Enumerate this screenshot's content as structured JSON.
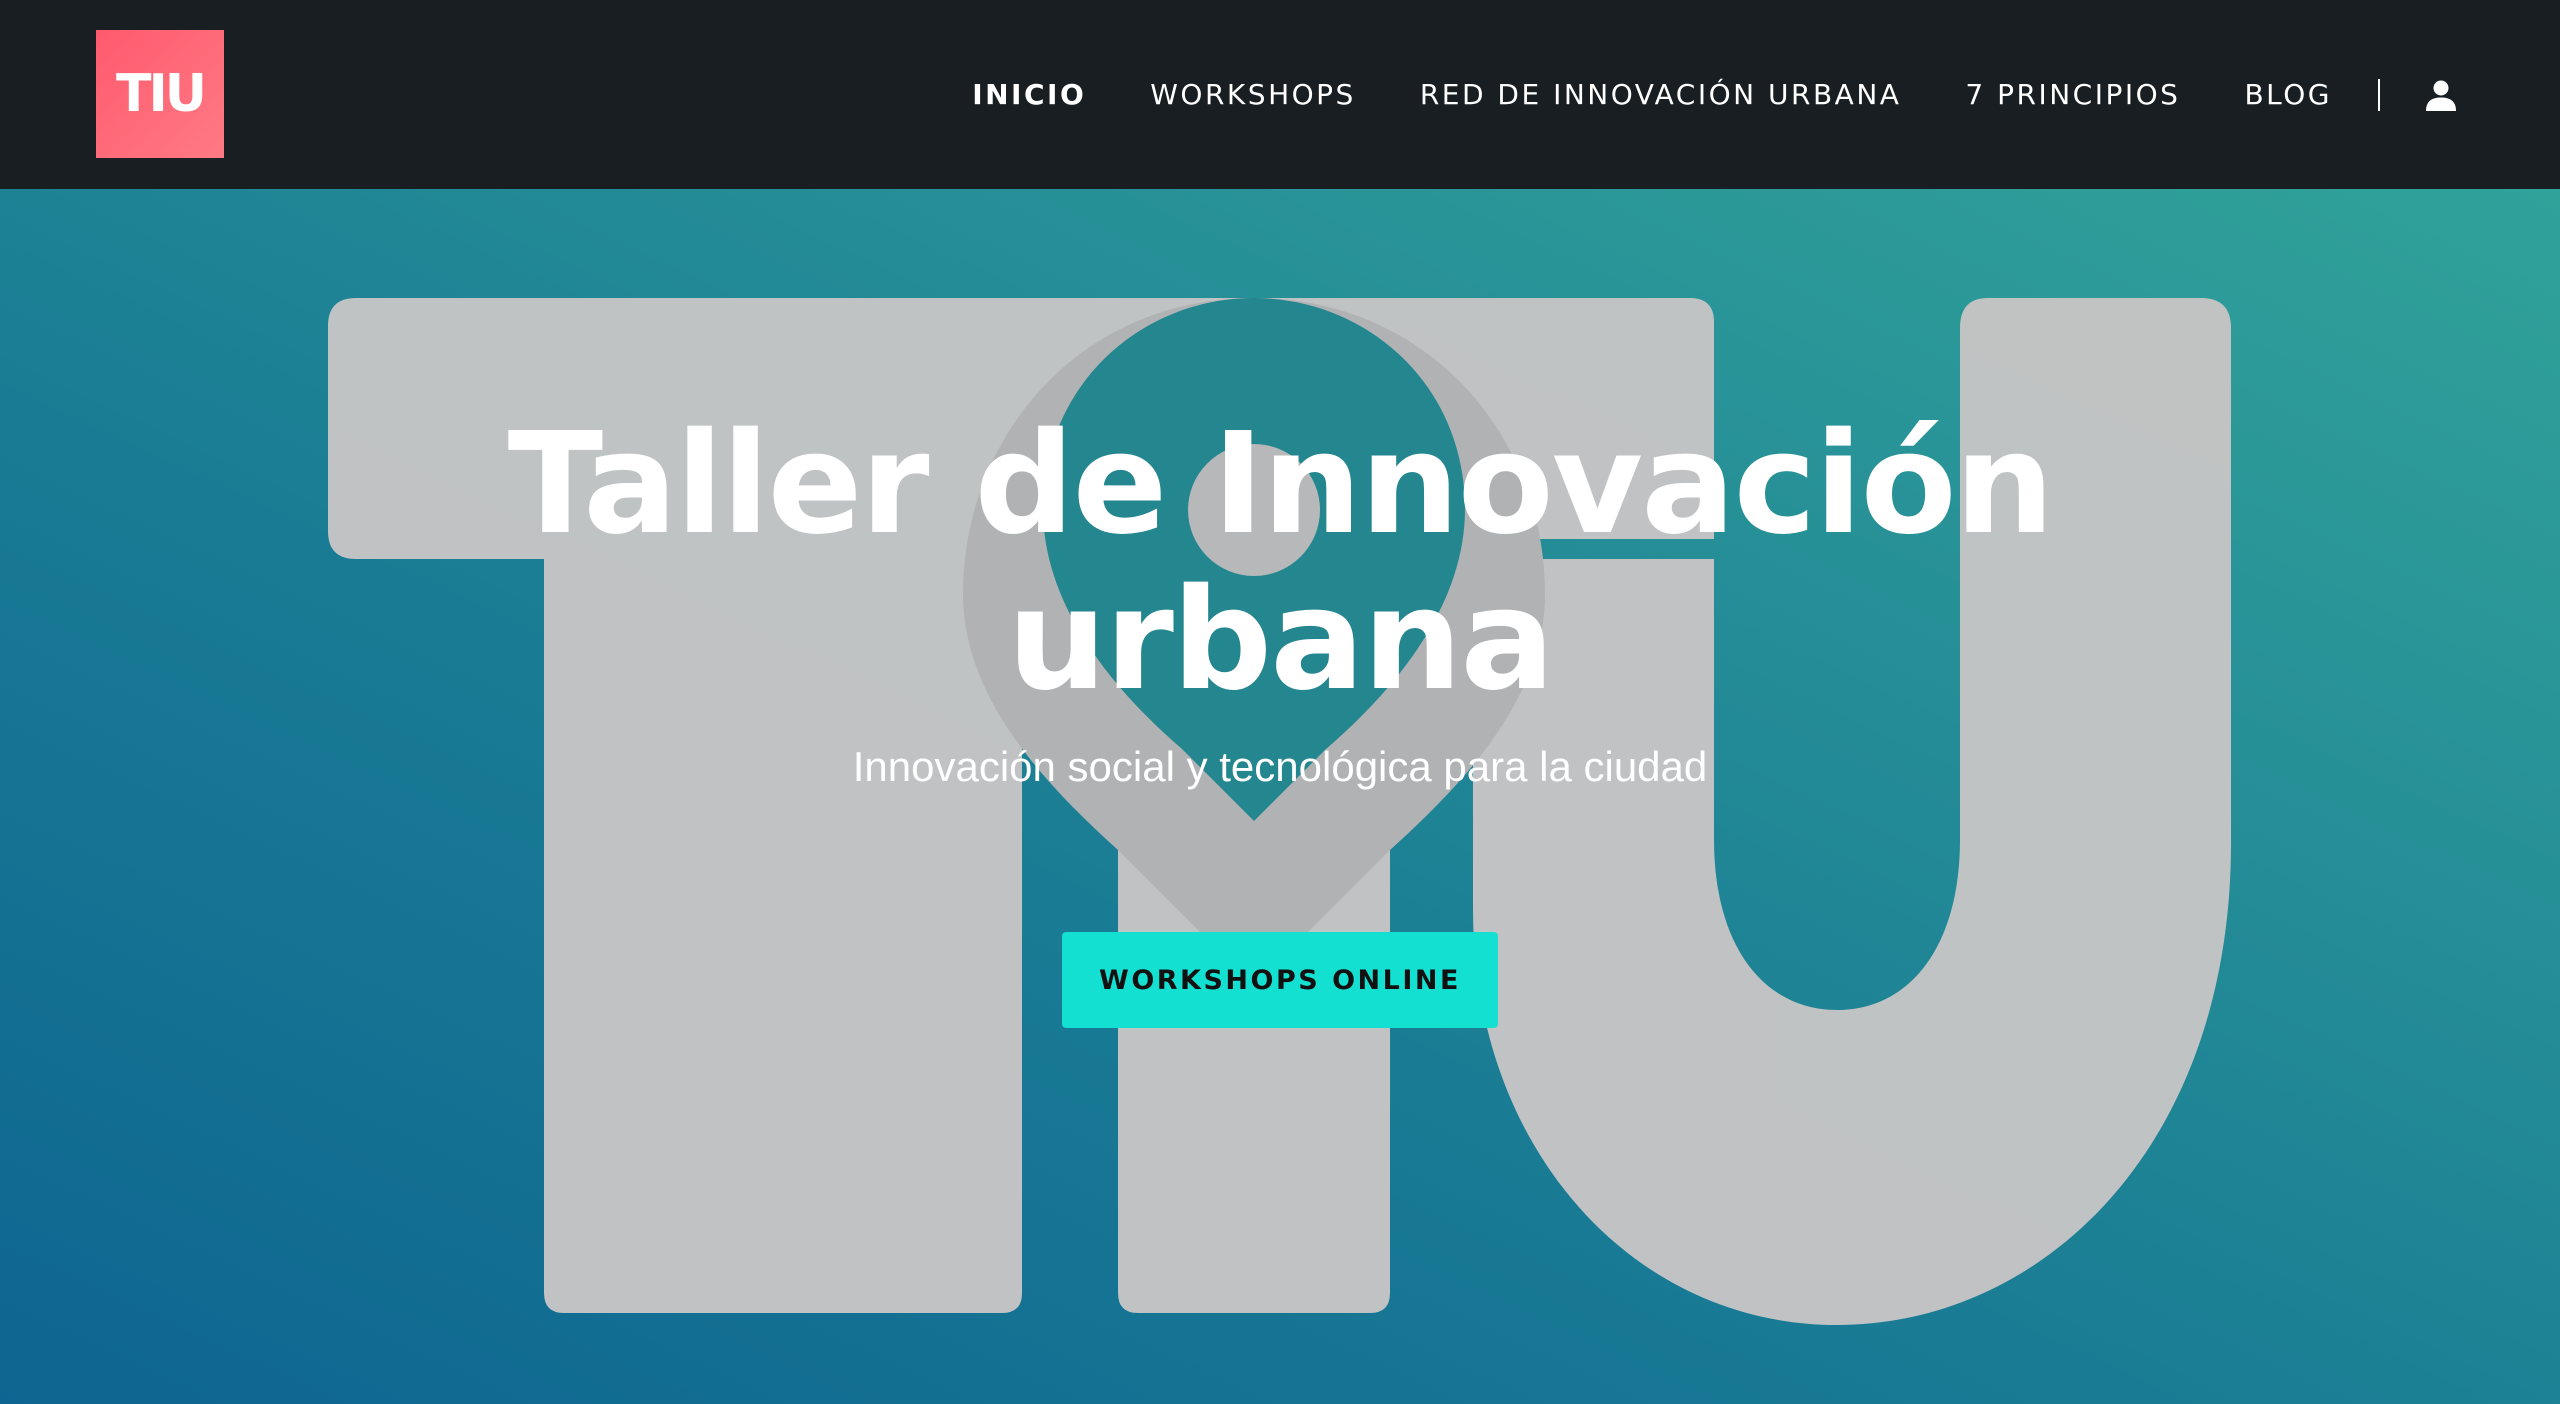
{
  "header": {
    "logo_text": "TIU",
    "nav": [
      {
        "label": "INICIO",
        "active": true
      },
      {
        "label": "WORKSHOPS",
        "active": false
      },
      {
        "label": "RED DE INNOVACIÓN URBANA",
        "active": false
      },
      {
        "label": "7 PRINCIPIOS",
        "active": false
      },
      {
        "label": "BLOG",
        "active": false
      }
    ],
    "user_icon": "user-icon"
  },
  "hero": {
    "background_logo": "TIU",
    "title_line1": "Taller de Innovación",
    "title_line2": "urbana",
    "subtitle": "Innovación social y tecnológica para la ciudad",
    "cta_label": "WORKSHOPS ONLINE"
  },
  "colors": {
    "header_bg": "#181e21",
    "logo_bg": "#ff6373",
    "cta_bg": "#14e0d2",
    "hero_gradient_start": "#0e6591",
    "hero_gradient_end": "#31a29a",
    "bg_mark": "#c4c4c4"
  }
}
